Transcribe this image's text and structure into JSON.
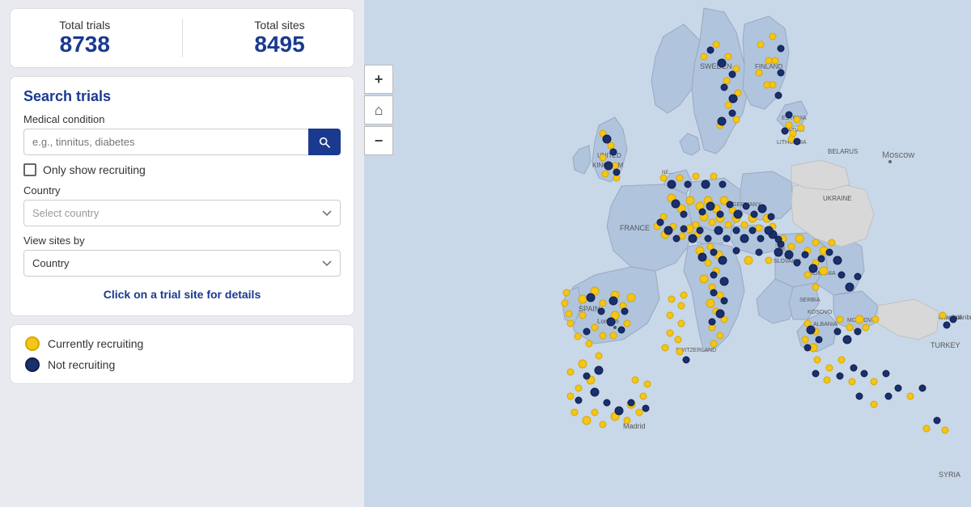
{
  "stats": {
    "total_trials_label": "Total trials",
    "total_trials_value": "8738",
    "total_sites_label": "Total sites",
    "total_sites_value": "8495"
  },
  "search": {
    "title": "Search trials",
    "condition_label": "Medical condition",
    "condition_placeholder": "e.g., tinnitus, diabetes",
    "only_recruiting_label": "Only show recruiting",
    "country_label": "Country",
    "country_placeholder": "Select country",
    "view_by_label": "View sites by",
    "view_by_value": "Country",
    "click_hint": "Click on a trial site for details"
  },
  "legend": {
    "recruiting_label": "Currently recruiting",
    "not_recruiting_label": "Not recruiting"
  },
  "map_controls": {
    "zoom_in": "+",
    "home": "⌂",
    "zoom_out": "−"
  }
}
